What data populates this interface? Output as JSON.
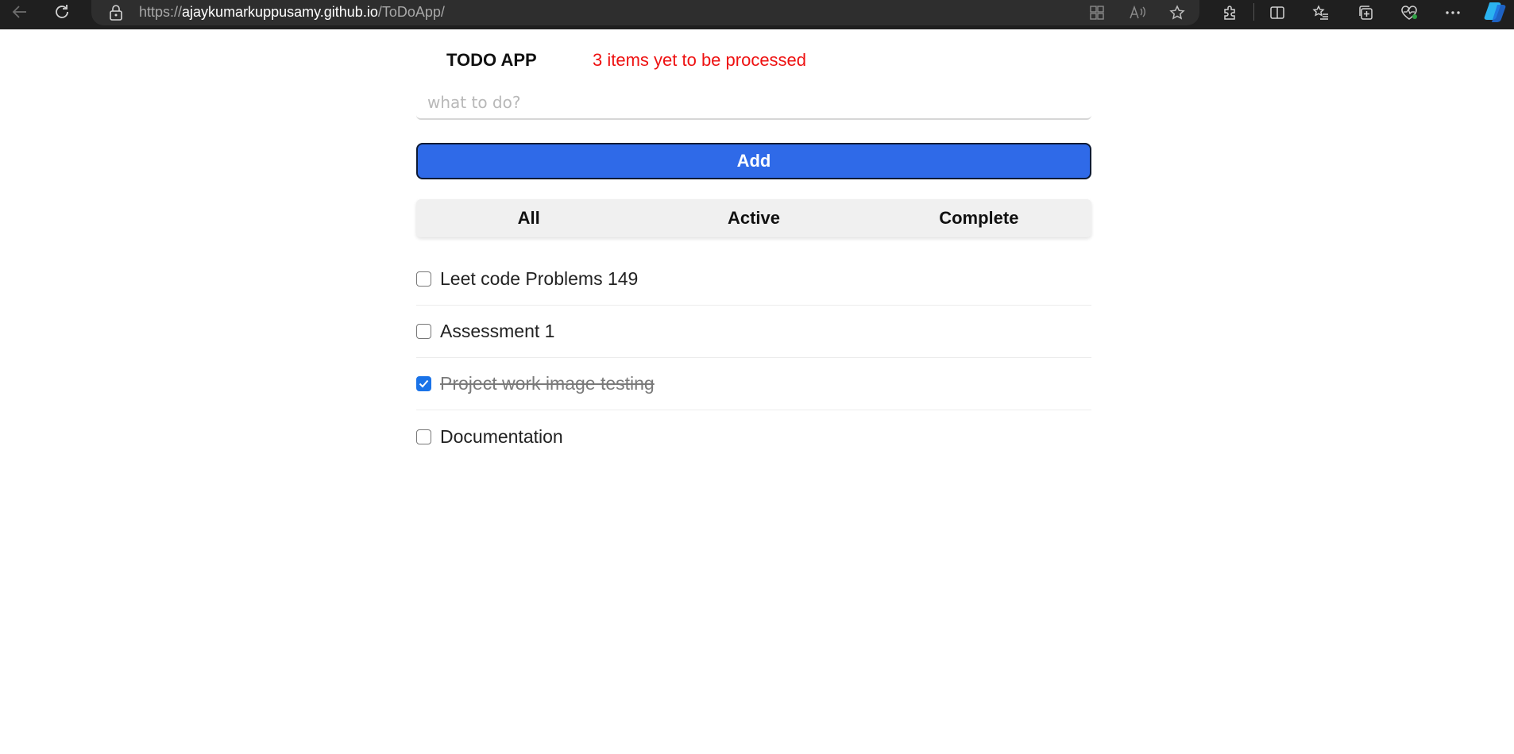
{
  "browser": {
    "url_scheme": "https://",
    "url_host": "ajaykumarkuppusamy.github.io",
    "url_path": "/ToDoApp/"
  },
  "app": {
    "title": "TODO APP",
    "pending_text": "3 items yet to be processed",
    "pending_color": "#ee1111",
    "input_placeholder": "what to do?",
    "input_value": "",
    "add_label": "Add",
    "accent_color": "#2f6ae8",
    "filters": [
      {
        "label": "All"
      },
      {
        "label": "Active"
      },
      {
        "label": "Complete"
      }
    ],
    "todos": [
      {
        "text": "Leet code Problems 149",
        "done": false
      },
      {
        "text": "Assessment 1",
        "done": false
      },
      {
        "text": "Project work image testing",
        "done": true
      },
      {
        "text": "Documentation",
        "done": false
      }
    ]
  },
  "icons": {
    "back": "back-arrow-icon",
    "refresh": "refresh-icon",
    "lock": "lock-icon",
    "apps": "app-grid-icon",
    "read_aloud": "read-aloud-icon",
    "favorite": "star-icon",
    "extensions": "puzzle-icon",
    "split": "split-screen-icon",
    "favorites": "favorites-list-icon",
    "collections": "collections-icon",
    "health": "browser-essentials-icon",
    "more": "more-icon",
    "copilot": "copilot-icon"
  }
}
